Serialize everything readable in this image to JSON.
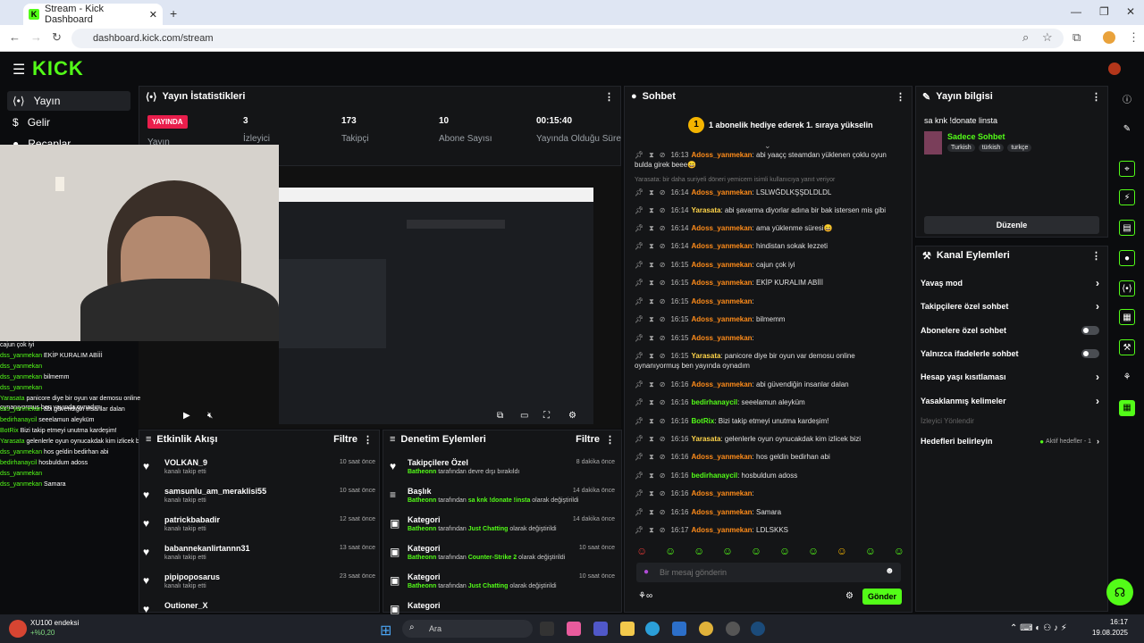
{
  "browser": {
    "tab_title": "Stream - Kick Dashboard",
    "url": "dashboard.kick.com/stream"
  },
  "nav": {
    "items": [
      {
        "label": "Yayın",
        "icon": "broadcast-icon"
      },
      {
        "label": "Gelir",
        "icon": "dollar-icon"
      },
      {
        "label": "Recaplar",
        "icon": "recap-icon"
      }
    ]
  },
  "stats": {
    "title": "Yayın İstatistikleri",
    "live_badge": "YAYINDA",
    "live_label": "Yayın",
    "viewers": "3",
    "viewers_label": "İzleyici",
    "followers": "173",
    "followers_label": "Takipçi",
    "subs": "10",
    "subs_label": "Abone Sayısı",
    "uptime": "00:15:40",
    "uptime_label": "Yayında Olduğu Süre"
  },
  "chat": {
    "title": "Sohbet",
    "gift_banner": "1 abonelik hediye ederek 1. sıraya yükselin",
    "reply_note": "Yarasata: bir daha suriyeli döneri yemicem isimli kullanıcıya yanıt veriyor",
    "messages": [
      {
        "time": "16:13",
        "user": "Adoss_yanmekan",
        "text": "abi yaaçç steamdan yüklenen çoklu oyun bulda girek beee😄",
        "cls": "u"
      },
      {
        "time": "16:14",
        "user": "Adoss_yanmekan",
        "text": "LSLWĞDLKŞŞDLDLDL",
        "cls": "u"
      },
      {
        "time": "16:14",
        "user": "Yarasata",
        "text": "abi şavarma diyorlar adına bir bak istersen mis gibi",
        "cls": "u3"
      },
      {
        "time": "16:14",
        "user": "Adoss_yanmekan",
        "text": "ama yüklenme süresi😄",
        "cls": "u"
      },
      {
        "time": "16:14",
        "user": "Adoss_yanmekan",
        "text": "hindistan sokak lezzeti",
        "cls": "u"
      },
      {
        "time": "16:15",
        "user": "Adoss_yanmekan",
        "text": "cajun çok iyi",
        "cls": "u"
      },
      {
        "time": "16:15",
        "user": "Adoss_yanmekan",
        "text": "EKİP KURALIM ABİİİ",
        "cls": "u"
      },
      {
        "time": "16:15",
        "user": "Adoss_yanmekan",
        "text": "",
        "cls": "u"
      },
      {
        "time": "16:15",
        "user": "Adoss_yanmekan",
        "text": "bilmemm",
        "cls": "u"
      },
      {
        "time": "16:15",
        "user": "Adoss_yanmekan",
        "text": "",
        "cls": "u"
      },
      {
        "time": "16:15",
        "user": "Yarasata",
        "text": "panicore diye bir oyun var demosu online oynanıyormuş ben yayında oynadım",
        "cls": "u3"
      },
      {
        "time": "16:16",
        "user": "Adoss_yanmekan",
        "text": "abi güvendiğin insanlar dalan",
        "cls": "u"
      },
      {
        "time": "16:16",
        "user": "bedirhanaycil",
        "text": "seeelamun aleyküm",
        "cls": "u2"
      },
      {
        "time": "16:16",
        "user": "BotRix",
        "text": "Bizi takip etmeyi unutma kardeşim!",
        "cls": "u2"
      },
      {
        "time": "16:16",
        "user": "Yarasata",
        "text": "gelenlerle oyun oynucakdak kim izlicek bizi",
        "cls": "u3"
      },
      {
        "time": "16:16",
        "user": "Adoss_yanmekan",
        "text": "hos geldin bedirhan abi",
        "cls": "u"
      },
      {
        "time": "16:16",
        "user": "bedirhanaycil",
        "text": "hosbuldum adoss",
        "cls": "u2"
      },
      {
        "time": "16:16",
        "user": "Adoss_yanmekan",
        "text": "",
        "cls": "u"
      },
      {
        "time": "16:16",
        "user": "Adoss_yanmekan",
        "text": "Samara",
        "cls": "u"
      },
      {
        "time": "16:17",
        "user": "Adoss_yanmekan",
        "text": "LDLSKKS",
        "cls": "u"
      }
    ],
    "placeholder": "Bir mesaj gönderin",
    "send": "Gönder"
  },
  "info": {
    "title": "Yayın bilgisi",
    "stream_title": "sa knk !donate linsta",
    "category": "Sadece Sohbet",
    "tags": [
      "Turkish",
      "türkish",
      "turkçe"
    ],
    "edit": "Düzenle"
  },
  "actions": {
    "title": "Kanal Eylemleri",
    "items": [
      {
        "label": "Yavaş mod",
        "type": "arrow"
      },
      {
        "label": "Takipçilere özel sohbet",
        "type": "arrow"
      },
      {
        "label": "Abonelere özel sohbet",
        "type": "toggle"
      },
      {
        "label": "Yalnızca ifadelerle sohbet",
        "type": "toggle"
      },
      {
        "label": "Hesap yaşı kısıtlaması",
        "type": "arrow"
      },
      {
        "label": "Yasaklanmış kelimeler",
        "type": "arrow"
      }
    ],
    "redirect": "İzleyici Yönlendir",
    "goals": "Hedefleri belirleyin",
    "goals_status": "Aktif hedefler - 1"
  },
  "events": {
    "title": "Etkinlik Akışı",
    "filter": "Filtre",
    "items": [
      {
        "name": "VOLKAN_9",
        "sub": "kanalı takip etti",
        "time": "10 saat önce"
      },
      {
        "name": "samsunlu_am_meraklisi55",
        "sub": "kanalı takip etti",
        "time": "10 saat önce"
      },
      {
        "name": "patrickbabadir",
        "sub": "kanalı takip etti",
        "time": "12 saat önce"
      },
      {
        "name": "babannekanlirtannn31",
        "sub": "kanalı takip etti",
        "time": "13 saat önce"
      },
      {
        "name": "pipipoposarus",
        "sub": "kanalı takip etti",
        "time": "23 saat önce"
      },
      {
        "name": "Outioner_X",
        "sub": "",
        "time": ""
      }
    ]
  },
  "moderation": {
    "title": "Denetim Eylemleri",
    "filter": "Filtre",
    "items": [
      {
        "name": "Takipçilere Özel",
        "by": "Batheonn",
        "mid": " tarafından devre dışı bırakıldı",
        "val": "",
        "end": "",
        "time": "8 dakika önce"
      },
      {
        "name": "Başlık",
        "by": "Batheonn",
        "mid": " tarafından ",
        "val": "sa knk !donate !insta",
        "end": " olarak değiştirildi",
        "time": "14 dakika önce"
      },
      {
        "name": "Kategori",
        "by": "Batheonn",
        "mid": " tarafından ",
        "val": "Just Chatting",
        "end": " olarak değiştirildi",
        "time": "14 dakika önce"
      },
      {
        "name": "Kategori",
        "by": "Batheonn",
        "mid": " tarafından ",
        "val": "Counter-Strike 2",
        "end": " olarak değiştirildi",
        "time": "10 saat önce"
      },
      {
        "name": "Kategori",
        "by": "Batheonn",
        "mid": " tarafından ",
        "val": "Just Chatting",
        "end": " olarak değiştirildi",
        "time": "10 saat önce"
      },
      {
        "name": "Kategori",
        "by": "",
        "mid": "",
        "val": "",
        "end": "",
        "time": ""
      }
    ]
  },
  "overlay_chat": [
    {
      "user": "",
      "text": "cajun çok iyi"
    },
    {
      "user": "dss_yanmekan",
      "text": "EKİP KURALIM ABİİİ"
    },
    {
      "user": "dss_yanmekan",
      "text": ""
    },
    {
      "user": "dss_yanmekan",
      "text": "bilmemm"
    },
    {
      "user": "dss_yanmekan",
      "text": ""
    },
    {
      "user": "Yarasata",
      "text": "panicore diye bir oyun var demosu online oynanıyormuş ben yayında oynadım"
    },
    {
      "user": "dss_yanmekan",
      "text": "abi güvendiğin insanlar dalan"
    },
    {
      "user": "bedirhanaycil",
      "text": "seeelamun aleyküm"
    },
    {
      "user": "BotRix",
      "text": "Bizi takip etmeyi unutma kardeşim!"
    },
    {
      "user": "Yarasata",
      "text": "gelenlerle oyun oynucakdak kim izlicek bizi"
    },
    {
      "user": "dss_yanmekan",
      "text": "hos geldin bedirhan abi"
    },
    {
      "user": "bedirhanaycil",
      "text": "hosbuldum adoss"
    },
    {
      "user": "dss_yanmekan",
      "text": ""
    },
    {
      "user": "dss_yanmekan",
      "text": "Samara"
    }
  ],
  "taskbar": {
    "weather": "XU100 endeksi",
    "weather_sub": "+%0,20",
    "search": "Ara",
    "time": "16:17",
    "date": "19.08.2025"
  },
  "colors": {
    "accent": "#53fc18",
    "live": "#e91e4c"
  }
}
